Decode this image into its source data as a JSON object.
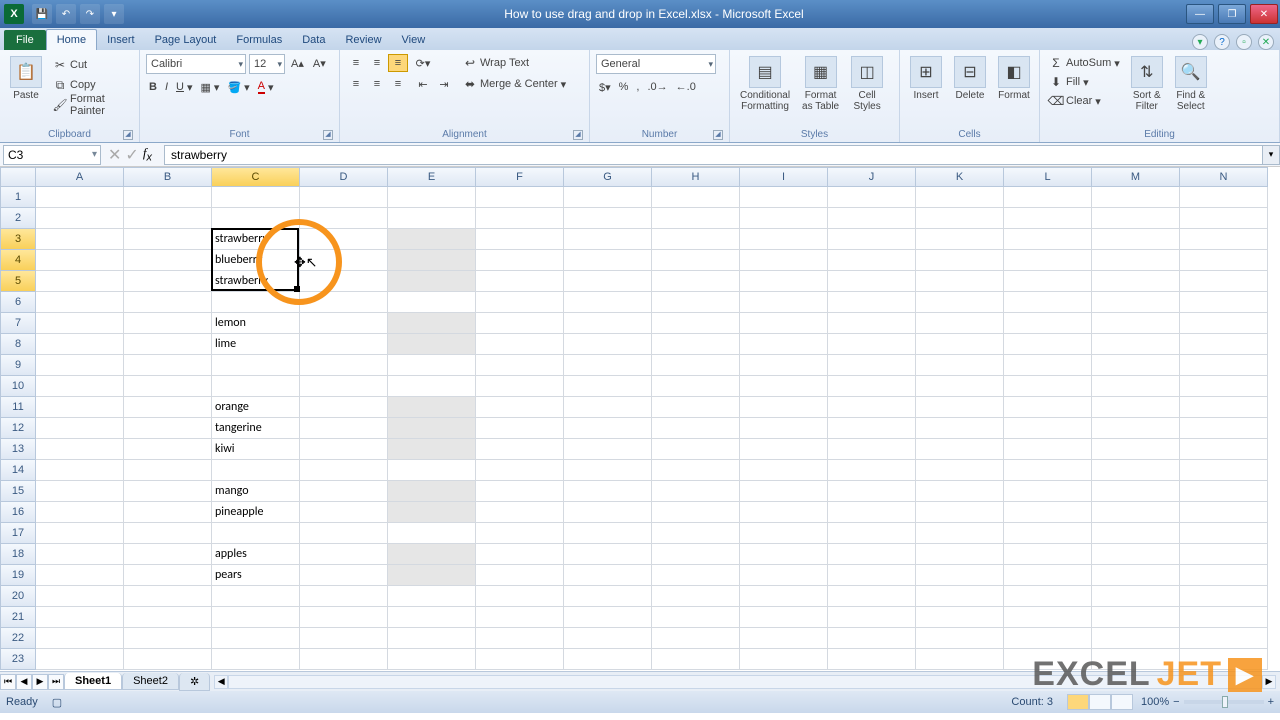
{
  "window": {
    "title": "How to use drag and drop in Excel.xlsx - Microsoft Excel"
  },
  "qat": {
    "save": "💾",
    "undo": "↶",
    "redo": "↷"
  },
  "tabs": {
    "file": "File",
    "items": [
      "Home",
      "Insert",
      "Page Layout",
      "Formulas",
      "Data",
      "Review",
      "View"
    ],
    "active": "Home"
  },
  "ribbon": {
    "clipboard": {
      "paste": "Paste",
      "cut": "Cut",
      "copy": "Copy",
      "format_painter": "Format Painter",
      "label": "Clipboard"
    },
    "font": {
      "name": "Calibri",
      "size": "12",
      "label": "Font"
    },
    "alignment": {
      "wrap": "Wrap Text",
      "merge": "Merge & Center",
      "label": "Alignment"
    },
    "number": {
      "format": "General",
      "label": "Number"
    },
    "styles": {
      "conditional": "Conditional\nFormatting",
      "as_table": "Format\nas Table",
      "cell_styles": "Cell\nStyles",
      "label": "Styles"
    },
    "cells": {
      "insert": "Insert",
      "delete": "Delete",
      "format": "Format",
      "label": "Cells"
    },
    "editing": {
      "autosum": "AutoSum",
      "fill": "Fill",
      "clear": "Clear",
      "sort": "Sort &\nFilter",
      "find": "Find &\nSelect",
      "label": "Editing"
    }
  },
  "namebox": "C3",
  "formula": "strawberry",
  "columns": [
    "A",
    "B",
    "C",
    "D",
    "E",
    "F",
    "G",
    "H",
    "I",
    "J",
    "K",
    "L",
    "M",
    "N"
  ],
  "selected_column": "C",
  "selected_rows": [
    3,
    4,
    5
  ],
  "row_count": 23,
  "cells": {
    "C3": "strawberry",
    "C4": "blueberry",
    "C5": "strawberry",
    "C7": "lemon",
    "C8": "lime",
    "C11": "orange",
    "C12": "tangerine",
    "C13": "kiwi",
    "C15": "mango",
    "C16": "pineapple",
    "C18": "apples",
    "C19": "pears"
  },
  "gray_cells": [
    "E3",
    "E4",
    "E5",
    "E7",
    "E8",
    "E11",
    "E12",
    "E13",
    "E15",
    "E16",
    "E18",
    "E19"
  ],
  "sheets": {
    "items": [
      "Sheet1",
      "Sheet2"
    ],
    "active": "Sheet1"
  },
  "statusbar": {
    "mode": "Ready",
    "count_label": "Count: 3",
    "zoom": "100%"
  },
  "watermark": {
    "a": "EXCEL",
    "b": "JET"
  }
}
